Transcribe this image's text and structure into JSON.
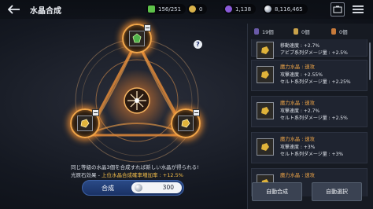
{
  "header": {
    "title": "水晶合成",
    "resources": [
      {
        "icon": "green-crystal-icon",
        "value": "156/251",
        "color": "#5ec24a"
      },
      {
        "icon": "gold-coin-icon",
        "value": "0",
        "color": "#d9b24a"
      },
      {
        "icon": "purple-gem-icon",
        "value": "1,138",
        "color": "#8a5ad8"
      },
      {
        "icon": "silver-coin-icon",
        "value": "8,116,465",
        "color": "#c9cfd8"
      }
    ]
  },
  "main": {
    "description_line1": "同じ等級の水晶3個を合成すれば新しい水晶が得られる!",
    "description_line2_prefix": "光原石効果 - ",
    "description_line2_highlight": "上位水晶合成確率増加率 : +12.5%",
    "combine_label": "合成",
    "combine_cost": "300"
  },
  "filters": [
    {
      "label": "19個",
      "color": "#6a5aa8"
    },
    {
      "label": "0個",
      "color": "#c9a24a"
    },
    {
      "label": "0個",
      "color": "#c77a3a"
    }
  ],
  "items": [
    {
      "name": "移動速度 : +2.7%",
      "line1": "アビブ系列ダメージ量 : +2.5%",
      "line2": "",
      "partial": true
    },
    {
      "name": "魔力水晶 : 速攻",
      "line1": "攻撃速度 : +2.55%",
      "line2": "セルト系列ダメージ量 : +2.25%"
    },
    {
      "name": "魔力水晶 : 速攻",
      "line1": "攻撃速度 : +2.7%",
      "line2": "セルト系列ダメージ量 : +2.5%"
    },
    {
      "name": "魔力水晶 : 速攻",
      "line1": "攻撃速度 : +3%",
      "line2": "セルト系列ダメージ量 : +3%"
    },
    {
      "name": "魔力水晶 : 速攻",
      "line1": "",
      "line2": ""
    }
  ],
  "buttons": {
    "auto_combine": "自動合成",
    "auto_select": "自動選択"
  }
}
